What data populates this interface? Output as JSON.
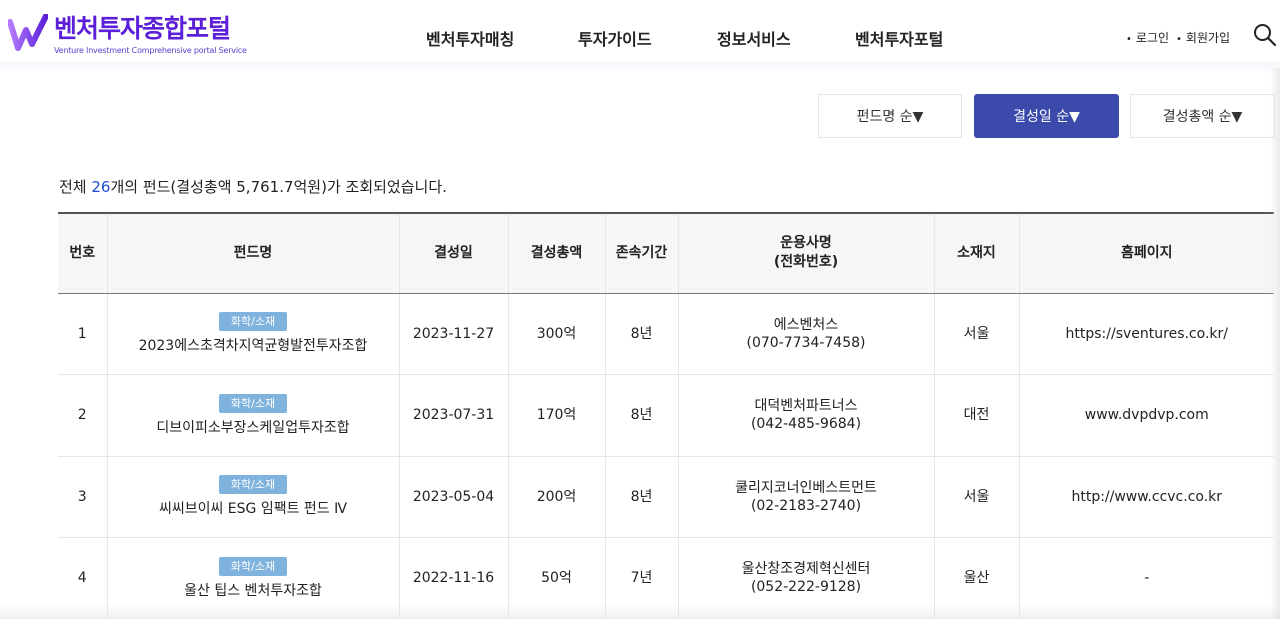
{
  "header": {
    "logo_title": "벤처투자종합포털",
    "logo_subtitle": "Venture Investment Comprehensive portal Service",
    "nav": [
      "벤처투자매칭",
      "투자가이드",
      "정보서비스",
      "벤처투자포털"
    ],
    "login": "로그인",
    "signup": "회원가입",
    "search_icon": "search-icon",
    "brand_color": "#5a1fd6"
  },
  "sort": {
    "by_name": "펀드명 순▼",
    "by_date": "결성일 순▼",
    "by_amount": "결성총액 순▼",
    "active": "by_date",
    "active_color": "#3c4bab"
  },
  "summary": {
    "prefix": "전체 ",
    "count": "26",
    "suffix": "개의 펀드(결성총액 5,761.7억원)가 조회되었습니다."
  },
  "table": {
    "headers": {
      "no": "번호",
      "name": "펀드명",
      "date": "결성일",
      "amount": "결성총액",
      "duration": "존속기간",
      "manager_line1": "운용사명",
      "manager_line2": "(전화번호)",
      "location": "소재지",
      "homepage": "홈페이지"
    },
    "rows": [
      {
        "no": "1",
        "category": "화학/소재",
        "name": "2023에스초격차지역균형발전투자조합",
        "date": "2023-11-27",
        "amount": "300억",
        "duration": "8년",
        "manager": "에스벤처스",
        "phone": "(070-7734-7458)",
        "location": "서울",
        "homepage": "https://sventures.co.kr/"
      },
      {
        "no": "2",
        "category": "화학/소재",
        "name": "디브이피소부장스케일업투자조합",
        "date": "2023-07-31",
        "amount": "170억",
        "duration": "8년",
        "manager": "대덕벤처파트너스",
        "phone": "(042-485-9684)",
        "location": "대전",
        "homepage": "www.dvpdvp.com"
      },
      {
        "no": "3",
        "category": "화학/소재",
        "name": "씨씨브이씨 ESG 임팩트 펀드 Ⅳ",
        "date": "2023-05-04",
        "amount": "200억",
        "duration": "8년",
        "manager": "쿨리지코너인베스트먼트",
        "phone": "(02-2183-2740)",
        "location": "서울",
        "homepage": "http://www.ccvc.co.kr"
      },
      {
        "no": "4",
        "category": "화학/소재",
        "name": "울산 팁스 벤처투자조합",
        "date": "2022-11-16",
        "amount": "50억",
        "duration": "7년",
        "manager": "울산창조경제혁신센터",
        "phone": "(052-222-9128)",
        "location": "울산",
        "homepage": "-"
      }
    ],
    "badge_color": "#7fb2dc"
  }
}
